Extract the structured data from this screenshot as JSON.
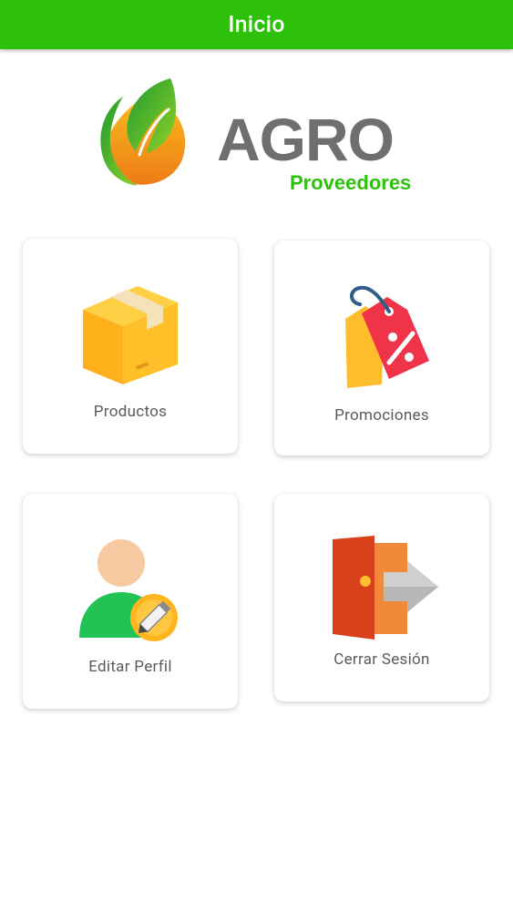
{
  "appbar": {
    "title": "Inicio",
    "color": "#2ec10b"
  },
  "logo": {
    "word": "AGRO",
    "subtitle": "Proveedores"
  },
  "menu": {
    "items": [
      {
        "label": "Productos",
        "icon": "box-icon"
      },
      {
        "label": "Promociones",
        "icon": "price-tag-icon"
      },
      {
        "label": "Editar Perfil",
        "icon": "edit-profile-icon"
      },
      {
        "label": "Cerrar Sesión",
        "icon": "logout-door-icon"
      }
    ]
  }
}
